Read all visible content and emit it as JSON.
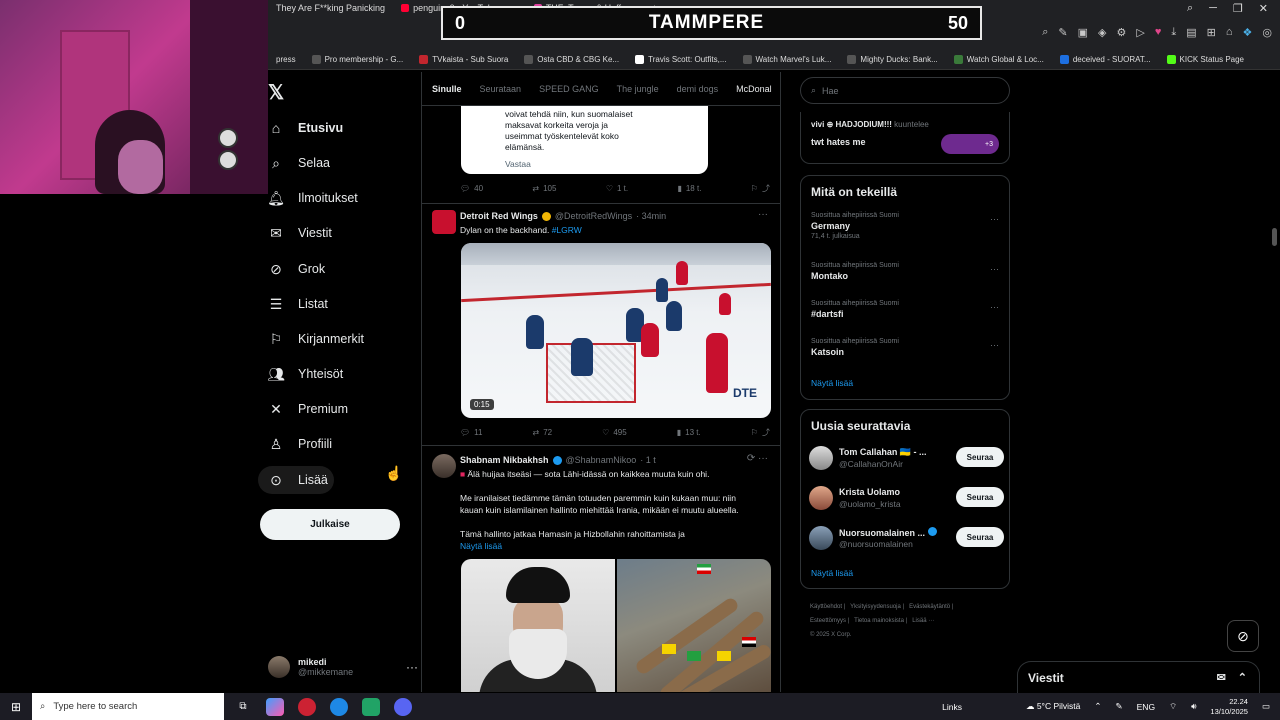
{
  "browser": {
    "tabs": [
      "They Are F**king Panicking",
      "penguinz0 - YouTube",
      "THF: Towns & Heffer..."
    ],
    "bookmarks": [
      "press",
      "Pro membership - G...",
      "TVkaista - Sub Suora",
      "Osta CBD & CBG Ke...",
      "Travis Scott: Outfits,...",
      "Watch Marvel's Luk...",
      "Mighty Ducks: Bank...",
      "Watch Global & Loc...",
      "deceived - SUORAT...",
      "KICK Status Page"
    ]
  },
  "score_overlay": {
    "left_score": "0",
    "title": "TAMMPERE",
    "right_score": "50"
  },
  "nav": {
    "items": [
      {
        "label": "Etusivu",
        "icon": "home-icon"
      },
      {
        "label": "Selaa",
        "icon": "search-icon"
      },
      {
        "label": "Ilmoitukset",
        "icon": "bell-icon"
      },
      {
        "label": "Viestit",
        "icon": "mail-icon"
      },
      {
        "label": "Grok",
        "icon": "grok-icon"
      },
      {
        "label": "Listat",
        "icon": "list-icon"
      },
      {
        "label": "Kirjanmerkit",
        "icon": "bookmark-icon"
      },
      {
        "label": "Yhteisöt",
        "icon": "people-icon"
      },
      {
        "label": "Premium",
        "icon": "x-icon"
      },
      {
        "label": "Profiili",
        "icon": "person-icon"
      },
      {
        "label": "Lisää",
        "icon": "more-icon"
      }
    ],
    "post_button": "Julkaise",
    "account": {
      "name": "mikedi",
      "handle": "@mikkemane"
    }
  },
  "feed": {
    "tabs": [
      "Sinulle",
      "Seurataan",
      "SPEED GANG",
      "The jungle",
      "demi dogs",
      "McDonal"
    ],
    "quote": {
      "lines": [
        "voivat tehdä niin, kun suomalaiset",
        "maksavat korkeita veroja ja",
        "useimmat työskentelevät koko",
        "elämänsä."
      ],
      "reply": "Vastaa"
    },
    "quote_actions": {
      "replies": "40",
      "reposts": "105",
      "likes": "1 t.",
      "views": "18 t."
    },
    "post1": {
      "name": "Detroit Red Wings",
      "handle": "@DetroitRedWings",
      "time": "· 34min",
      "text": "Dylan on the backhand.",
      "hashtag": "#LGRW",
      "video_time": "0:15",
      "video_brand": "DTE",
      "actions": {
        "replies": "11",
        "reposts": "72",
        "likes": "495",
        "views": "13 t."
      }
    },
    "post2": {
      "name": "Shabnam Nikbakhsh",
      "handle": "@ShabnamNikoo",
      "time": "· 1 t",
      "line1": "Älä huijaa itseäsi — sota Lähi-idässä on kaikkea muuta kuin ohi.",
      "para1a": "Me iranilaiset tiedämme tämän totuuden paremmin kuin kukaan muu: niin",
      "para1b": "kauan kuin islamilainen hallinto miehittää Irania, mikään ei muutu alueella.",
      "para2": "Tämä hallinto jatkaa Hamasin ja Hizbollahin rahoittamista ja",
      "show_more": "Näytä lisää"
    }
  },
  "right": {
    "search_placeholder": "Hae",
    "space": {
      "host": "vivi ⊕ HADJODIUM!!!",
      "status": "kuuntelee",
      "title": "twt hates me",
      "extra": "+3"
    },
    "trends_title": "Mitä on tekeillä",
    "trends": [
      {
        "context": "Suosittua aihepiirissä Suomi",
        "name": "Germany",
        "count": "71,4 t. julkaisua"
      },
      {
        "context": "Suosittua aihepiirissä Suomi",
        "name": "Montako",
        "count": ""
      },
      {
        "context": "Suosittua aihepiirissä Suomi",
        "name": "#dartsfi",
        "count": ""
      },
      {
        "context": "Suosittua aihepiirissä Suomi",
        "name": "Katsoin",
        "count": ""
      }
    ],
    "show_more": "Näytä lisää",
    "follow_title": "Uusia seurattavia",
    "follow": [
      {
        "name": "Tom Callahan 🇺🇦 - ...",
        "handle": "@CallahanOnAir",
        "button": "Seuraa"
      },
      {
        "name": "Krista Uolamo",
        "handle": "@uolamo_krista",
        "button": "Seuraa"
      },
      {
        "name": "Nuorsuomalainen ...",
        "handle": "@nuorsuomalainen",
        "button": "Seuraa"
      }
    ],
    "footer": [
      "Käyttöehdot",
      "Yksityisyydensuoja",
      "Evästekäytäntö",
      "Esteettömyys",
      "Tietoa mainoksista",
      "Lisää ···",
      "© 2025 X Corp."
    ]
  },
  "messages_label": "Viestit",
  "taskbar": {
    "search_placeholder": "Type here to search",
    "links": "Links",
    "weather": "5°C Pilvistä",
    "lang": "ENG",
    "time": "22.24",
    "date": "13/10/2025"
  }
}
